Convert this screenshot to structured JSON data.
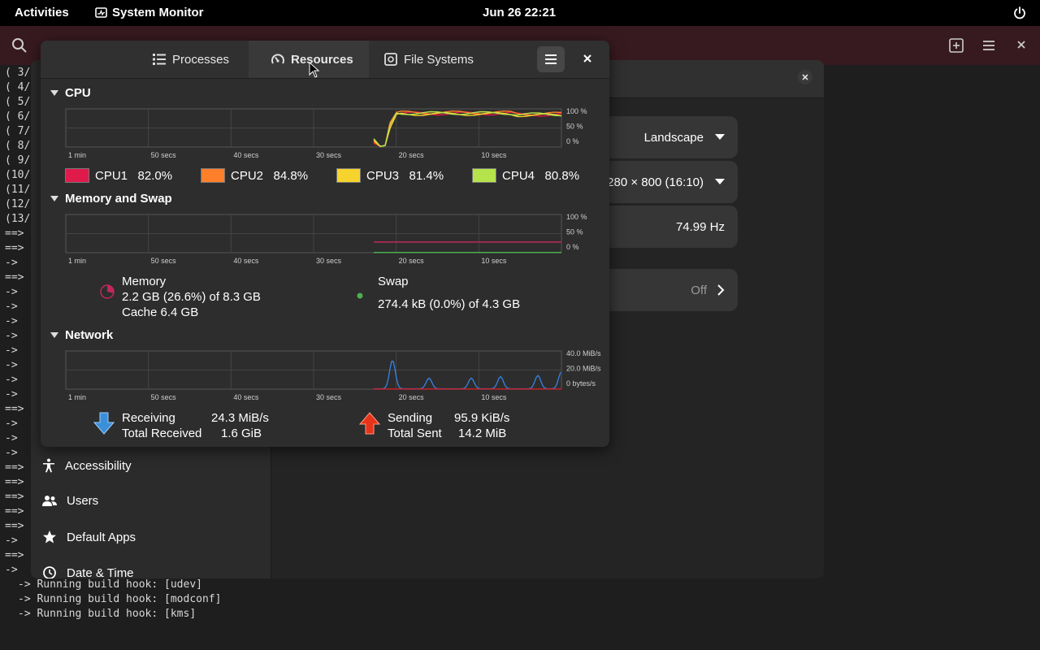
{
  "topbar": {
    "activities": "Activities",
    "app_name": "System Monitor",
    "clock": "Jun 26  22:21"
  },
  "terminal": {
    "left_lines": [
      "( 3/",
      "( 4/",
      "( 5/",
      "( 6/",
      "( 7/",
      "( 8/",
      "( 9/",
      "(10/",
      "(11/",
      "(12/",
      "(13/",
      "==>",
      "==>",
      "->",
      "==>",
      "->",
      "->",
      "->",
      "->",
      "->",
      "->",
      "->",
      "->",
      "==>",
      "->",
      "->",
      "->",
      "==>",
      "==>",
      "==>",
      "==>",
      "==>",
      "->",
      "==>",
      "->"
    ],
    "bottom_lines": [
      "-> Running build hook: [udev]",
      "-> Running build hook: [modconf]",
      "-> Running build hook: [kms]"
    ]
  },
  "settings": {
    "sidebar_items": [
      {
        "label": "Accessibility",
        "icon": "accessibility-icon"
      },
      {
        "label": "Users",
        "icon": "users-icon"
      },
      {
        "label": "Default Apps",
        "icon": "star-icon"
      },
      {
        "label": "Date & Time",
        "icon": "clock-icon"
      }
    ],
    "orientation": "Landscape",
    "resolution": "1280 × 800 (16:10)",
    "refresh_rate": "74.99 Hz",
    "night_light": "Off"
  },
  "sysmon": {
    "tabs": [
      {
        "label": "Processes",
        "icon": "list-icon"
      },
      {
        "label": "Resources",
        "icon": "gauge-icon",
        "active": true
      },
      {
        "label": "File Systems",
        "icon": "drive-icon"
      }
    ],
    "time_ticks": [
      "1 min",
      "50 secs",
      "40 secs",
      "30 secs",
      "20 secs",
      "10 secs"
    ],
    "cpu": {
      "title": "CPU",
      "y_ticks": [
        "100 %",
        "50 %",
        "0 %"
      ],
      "cores": [
        {
          "name": "CPU1",
          "value": "82.0%",
          "color": "#e01b4b"
        },
        {
          "name": "CPU2",
          "value": "84.8%",
          "color": "#ff7f2a"
        },
        {
          "name": "CPU3",
          "value": "81.4%",
          "color": "#f6d32d"
        },
        {
          "name": "CPU4",
          "value": "80.8%",
          "color": "#b5e34b"
        }
      ]
    },
    "memory": {
      "title": "Memory and Swap",
      "y_ticks": [
        "100 %",
        "50 %",
        "0 %"
      ],
      "mem_label": "Memory",
      "mem_used": "2.2 GB (26.6%) of 8.3 GB",
      "mem_cache": "Cache 6.4 GB",
      "mem_color": "#c0285a",
      "swap_label": "Swap",
      "swap_used": "274.4 kB (0.0%) of 4.3 GB",
      "swap_color": "#4caf50"
    },
    "network": {
      "title": "Network",
      "y_ticks": [
        "40.0 MiB/s",
        "20.0 MiB/s",
        "0 bytes/s"
      ],
      "receiving_label": "Receiving",
      "receiving_value": "24.3 MiB/s",
      "total_received_label": "Total Received",
      "total_received_value": "1.6 GiB",
      "sending_label": "Sending",
      "sending_value": "95.9 KiB/s",
      "total_sent_label": "Total Sent",
      "total_sent_value": "14.2 MiB"
    }
  }
}
